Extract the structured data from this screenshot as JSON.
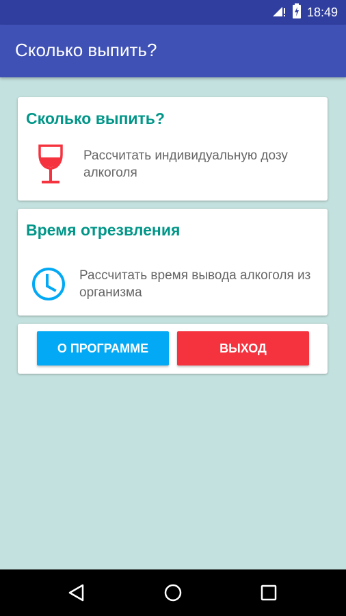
{
  "status_bar": {
    "time": "18:49",
    "icons": [
      "signal-alert-icon",
      "battery-charging-icon"
    ]
  },
  "app_bar": {
    "title": "Сколько выпить?"
  },
  "cards": {
    "dose": {
      "title": "Сколько выпить?",
      "description": "Рассчитать индивидуальную дозу алкоголя",
      "icon": "wine-glass-icon",
      "icon_color": "#f5333f"
    },
    "sober": {
      "title": "Время отрезвления",
      "description": "Рассчитать время вывода алкоголя из организма",
      "icon": "clock-icon",
      "icon_color": "#03a9f4"
    }
  },
  "buttons": {
    "about_label": "О ПРОГРАММЕ",
    "exit_label": "ВЫХОД"
  },
  "nav_bar": {
    "icons": [
      "back-icon",
      "home-icon",
      "recents-icon"
    ]
  },
  "colors": {
    "primary": "#3f51b5",
    "primary_dark": "#303f9f",
    "accent_title": "#009688",
    "background": "#c3e1de",
    "about_button": "#03a9f4",
    "exit_button": "#f5333f"
  }
}
